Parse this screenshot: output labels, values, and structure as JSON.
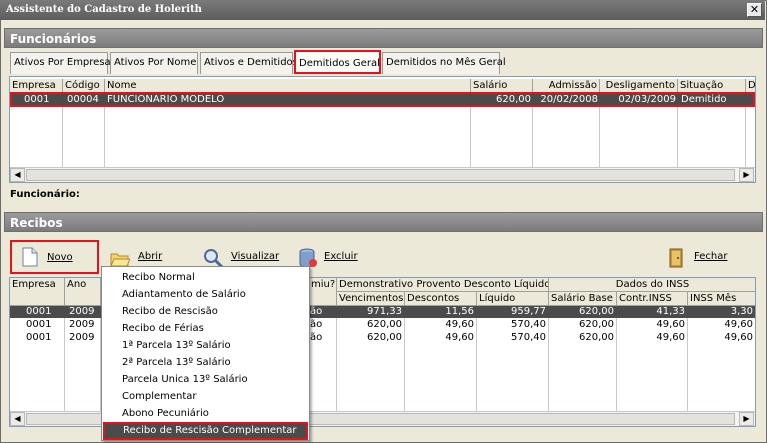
{
  "window": {
    "title": "Assistente do Cadastro de Holerith",
    "close_glyph": "✕"
  },
  "funcionarios": {
    "header": "Funcionários",
    "tabs": [
      {
        "label": "Ativos Por Empresa"
      },
      {
        "label": "Ativos Por Nome"
      },
      {
        "label": "Ativos e Demitidos"
      },
      {
        "label": "Demitidos Geral"
      },
      {
        "label": "Demitidos no Mês Geral"
      }
    ],
    "active_tab": "Demitidos Geral",
    "columns": [
      "Empresa",
      "Código",
      "Nome",
      "Salário",
      "Admissão",
      "Desligamento",
      "Situação",
      "D"
    ],
    "rows": [
      {
        "empresa": "0001",
        "codigo": "00004",
        "nome": "FUNCIONARIO MODELO",
        "salario": "620,00",
        "admissao": "20/02/2008",
        "desligamento": "02/03/2009",
        "situacao": "Demitido"
      }
    ],
    "funcionario_label": "Funcionário:"
  },
  "recibos": {
    "header": "Recibos",
    "toolbar": {
      "novo": "Novo",
      "abrir": "Abrir",
      "visualizar": "Visualizar",
      "excluir": "Excluir",
      "fechar": "Fechar"
    },
    "columns": {
      "empresa": "Empresa",
      "ano": "Ano",
      "partial": "miu?",
      "group1": "Demonstrativo Provento Desconto Líquido",
      "vencimentos": "Vencimentos",
      "descontos": "Descontos",
      "liquido": "Líquido",
      "group2": "Dados do INSS",
      "salario_base": "Salário Base",
      "contr_inss": "Contr.INSS",
      "inss_mes": "INSS Mês"
    },
    "rows": [
      {
        "empresa": "0001",
        "ano": "2009",
        "partial": "ão",
        "vencimentos": "971,33",
        "descontos": "11,56",
        "liquido": "959,77",
        "salario_base": "620,00",
        "contr_inss": "41,33",
        "inss_mes": "3,30"
      },
      {
        "empresa": "0001",
        "ano": "2009",
        "partial": "ão",
        "vencimentos": "620,00",
        "descontos": "49,60",
        "liquido": "570,40",
        "salario_base": "620,00",
        "contr_inss": "49,60",
        "inss_mes": "49,60"
      },
      {
        "empresa": "0001",
        "ano": "2009",
        "partial": "ão",
        "vencimentos": "620,00",
        "descontos": "49,60",
        "liquido": "570,40",
        "salario_base": "620,00",
        "contr_inss": "49,60",
        "inss_mes": "49,60"
      }
    ]
  },
  "menu": {
    "items": [
      "Recibo Normal",
      "Adiantamento de Salário",
      "Recibo de Rescisão",
      "Recibo de Férias",
      "1ª Parcela 13º Salário",
      "2ª Parcela 13º Salário",
      "Parcela Unica 13º Salário",
      "Complementar",
      "Abono Pecuniário",
      "Recibo de Rescisão Complementar"
    ],
    "highlighted": "Recibo de Rescisão Complementar"
  },
  "colors": {
    "highlight_box": "#e8101a",
    "selection": "#4b4b4b"
  }
}
